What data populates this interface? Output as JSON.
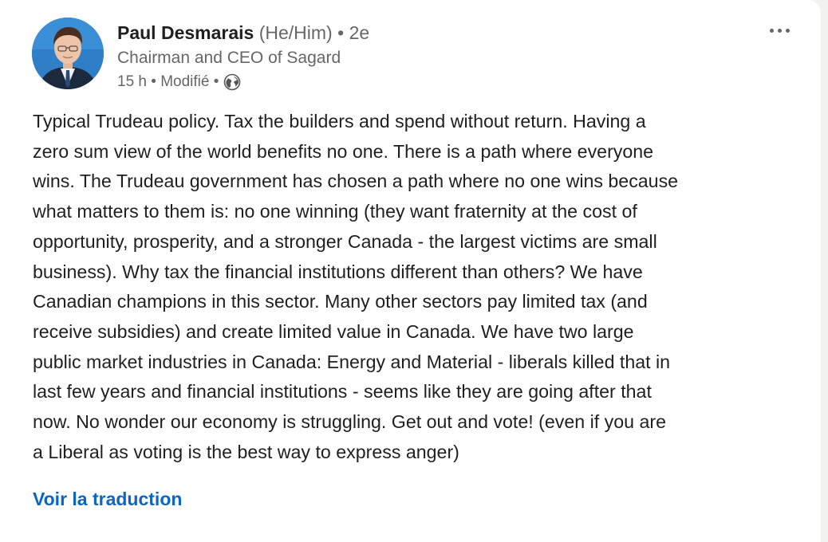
{
  "post": {
    "author_name": "Paul Desmarais",
    "pronouns": "(He/Him)",
    "separator": "•",
    "connection_degree": "2e",
    "headline": "Chairman and CEO of Sagard",
    "timestamp": "15 h",
    "edited_label": "Modifié",
    "visibility_icon": "globe-icon",
    "more_icon": "more-horizontal-icon",
    "body_lines": [
      "Typical Trudeau policy. Tax the builders and spend without return. Having a",
      "zero sum view of the world benefits no one. There is a path where everyone",
      "wins. The Trudeau government has chosen a path where no one wins because",
      "what matters to them is: no one winning (they want fraternity at the cost of",
      "opportunity, prosperity, and a stronger Canada - the largest victims are small",
      "business). Why tax the financial institutions different than others? We have",
      "Canadian champions in this sector. Many other sectors pay limited tax (and",
      "receive subsidies) and create limited value in Canada. We have two large",
      "public market industries in Canada: Energy and Material - liberals killed that in",
      "last few years and financial institutions - seems like they are going after that",
      "now. No wonder our economy is struggling. Get out and vote! (even if you are",
      "a Liberal as voting is the best way to express anger)"
    ],
    "translate_label": "Voir la traduction"
  },
  "colors": {
    "link": "#0a66c2",
    "secondary_text": "#666666",
    "primary_text": "#1f1f1f",
    "card_bg": "#ffffff",
    "page_bg": "#f3f2ef"
  }
}
